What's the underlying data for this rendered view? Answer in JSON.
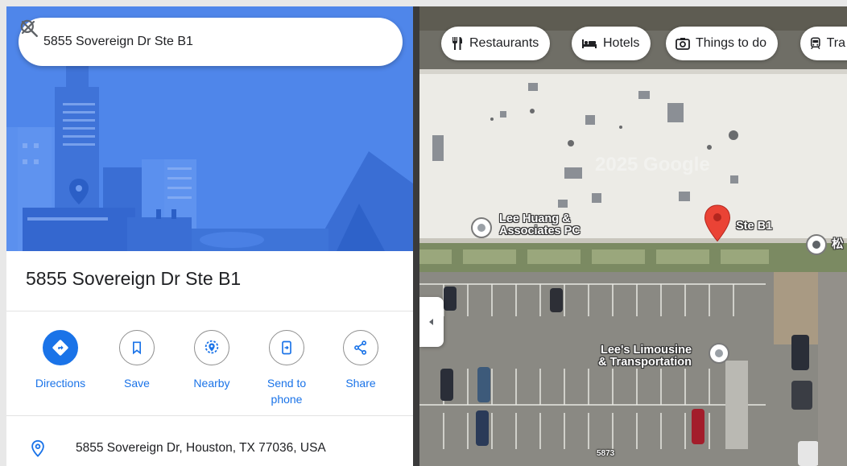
{
  "search": {
    "query": "5855 Sovereign Dr Ste B1"
  },
  "place": {
    "title": "5855 Sovereign Dr Ste B1",
    "address": "5855 Sovereign Dr, Houston, TX 77036, USA"
  },
  "actions": [
    {
      "label": "Directions",
      "icon": "directions-icon"
    },
    {
      "label": "Save",
      "icon": "bookmark-icon"
    },
    {
      "label": "Nearby",
      "icon": "nearby-icon"
    },
    {
      "label": "Send to phone",
      "icon": "send-to-phone-icon"
    },
    {
      "label": "Share",
      "icon": "share-icon"
    }
  ],
  "chips": [
    {
      "label": "Restaurants",
      "icon": "fork-knife-icon"
    },
    {
      "label": "Hotels",
      "icon": "bed-icon"
    },
    {
      "label": "Things to do",
      "icon": "camera-icon"
    },
    {
      "label": "Tra",
      "icon": "transit-icon"
    }
  ],
  "map": {
    "watermark": "2025 Google",
    "pin_label": "Ste B1",
    "poi_1_line1": "Lee Huang &",
    "poi_1_line2": "Associates PC",
    "poi_2_line1": "Lee's Limousine",
    "poi_2_line2": "& Transportation",
    "poi_3_label": "松",
    "building_number": "5873"
  },
  "colors": {
    "accent": "#1a73e8",
    "hero": "#4f86ea",
    "pin": "#ea4335"
  }
}
